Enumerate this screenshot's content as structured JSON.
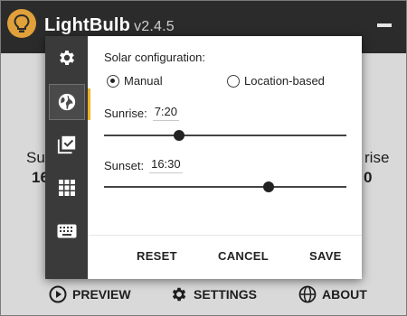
{
  "app": {
    "name": "LightBulb",
    "version": "v2.4.5"
  },
  "background": {
    "left_label": "Su",
    "left_value": "16",
    "right_label": "rise",
    "right_value": "0"
  },
  "bottom_nav": {
    "preview": "PREVIEW",
    "settings": "SETTINGS",
    "about": "ABOUT"
  },
  "sidebar": {
    "items": [
      {
        "icon": "gear-icon"
      },
      {
        "icon": "globe-icon",
        "active": true
      },
      {
        "icon": "checkbox-icon"
      },
      {
        "icon": "grid-icon"
      },
      {
        "icon": "keyboard-icon"
      }
    ]
  },
  "solar": {
    "heading": "Solar configuration:",
    "mode_manual": "Manual",
    "mode_location": "Location-based",
    "selected_mode": "Manual",
    "sunrise_label": "Sunrise:",
    "sunrise_value": "7:20",
    "sunrise_slider_fraction": 0.31,
    "sunset_label": "Sunset:",
    "sunset_value": "16:30",
    "sunset_slider_fraction": 0.68
  },
  "footer": {
    "reset": "RESET",
    "cancel": "CANCEL",
    "save": "SAVE"
  },
  "colors": {
    "accent": "#f0b428",
    "titlebar": "#2b2b2b",
    "sidebar": "#3a3a3a"
  }
}
